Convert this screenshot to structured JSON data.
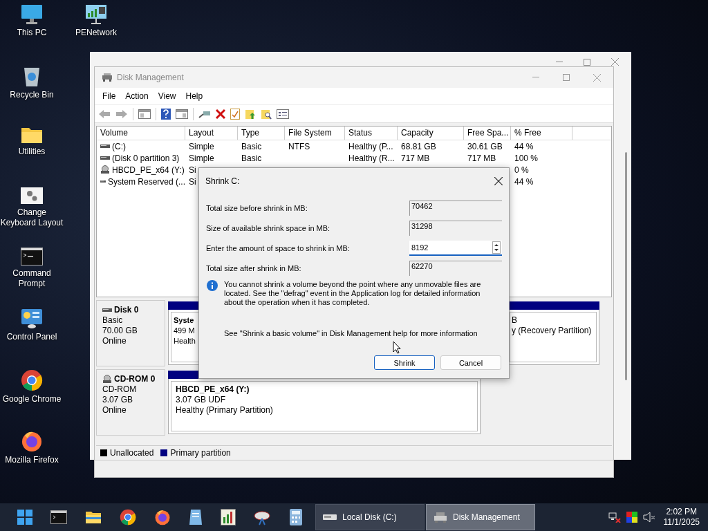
{
  "desktop_icons": [
    {
      "label": "This PC",
      "kind": "monitor"
    },
    {
      "label": "PENetwork",
      "kind": "network"
    },
    {
      "label": "Recycle Bin",
      "kind": "recycle"
    },
    {
      "label": "Utilities",
      "kind": "folder"
    },
    {
      "label": "Change Keyboard Layout",
      "kind": "gears"
    },
    {
      "label": "Command Prompt",
      "kind": "terminal"
    },
    {
      "label": "Control Panel",
      "kind": "control"
    },
    {
      "label": "Google Chrome",
      "kind": "chrome"
    },
    {
      "label": "Mozilla Firefox",
      "kind": "firefox"
    }
  ],
  "window": {
    "title": "Disk Management",
    "menu": [
      "File",
      "Action",
      "View",
      "Help"
    ],
    "volume_table": {
      "columns": [
        "Volume",
        "Layout",
        "Type",
        "File System",
        "Status",
        "Capacity",
        "Free Spa...",
        "% Free"
      ],
      "rows": [
        {
          "kind": "disk",
          "cells": [
            "(C:)",
            "Simple",
            "Basic",
            "NTFS",
            "Healthy (P...",
            "68.81 GB",
            "30.61 GB",
            "44 %"
          ]
        },
        {
          "kind": "disk",
          "cells": [
            "(Disk 0 partition 3)",
            "Simple",
            "Basic",
            null,
            "Healthy (R...",
            "717 MB",
            "717 MB",
            "100 %"
          ]
        },
        {
          "kind": "cdrom",
          "cells": [
            "HBCD_PE_x64 (Y:)",
            "Si",
            null,
            null,
            null,
            null,
            null,
            "0 %"
          ]
        },
        {
          "kind": "disk",
          "cells": [
            "System Reserved (...",
            "Si",
            null,
            null,
            null,
            null,
            null,
            "44 %"
          ]
        }
      ]
    },
    "disks": [
      {
        "kind": "disk",
        "name": "Disk 0",
        "lines": [
          "Basic",
          "70.00 GB",
          "Online"
        ],
        "partitions": [
          {
            "title": "Syste",
            "lines": [
              "499 M",
              "Health"
            ]
          },
          {
            "lines": [
              "B",
              "y (Recovery Partition)"
            ]
          }
        ]
      },
      {
        "kind": "cdrom",
        "name": "CD-ROM 0",
        "lines": [
          "CD-ROM",
          "3.07 GB",
          "Online"
        ],
        "partitions": [
          {
            "title": "HBCD_PE_x64  (Y:)",
            "lines": [
              "3.07 GB UDF",
              "Healthy (Primary Partition)"
            ]
          }
        ]
      }
    ],
    "legend": [
      {
        "label": "Unallocated",
        "color": "#000000"
      },
      {
        "label": "Primary partition",
        "color": "#000080"
      }
    ]
  },
  "dialog": {
    "title": "Shrink C:",
    "fields": [
      {
        "label": "Total size before shrink in MB:",
        "value": "70462",
        "kind": "readonly"
      },
      {
        "label": "Size of available shrink space in MB:",
        "value": "31298",
        "kind": "readonly"
      },
      {
        "label": "Enter the amount of space to shrink in MB:",
        "value": "8192",
        "kind": "spin"
      },
      {
        "label": "Total size after shrink in MB:",
        "value": "62270",
        "kind": "readonly"
      }
    ],
    "info": "You cannot shrink a volume beyond the point where any unmovable files are located. See the \"defrag\" event in the Application log for detailed information about the operation when it has completed.",
    "help": "See \"Shrink a basic volume\" in Disk Management help for more information",
    "buttons": [
      {
        "label": "Shrink",
        "default": true
      },
      {
        "label": "Cancel",
        "default": false
      }
    ]
  },
  "taskbar": {
    "windows": [
      {
        "label": "Local Disk (C:)",
        "kind": "drive",
        "selected": false
      },
      {
        "label": "Disk Management",
        "kind": "diskmgmt",
        "selected": true
      }
    ],
    "time": "2:02 PM",
    "date": "11/1/2025"
  }
}
